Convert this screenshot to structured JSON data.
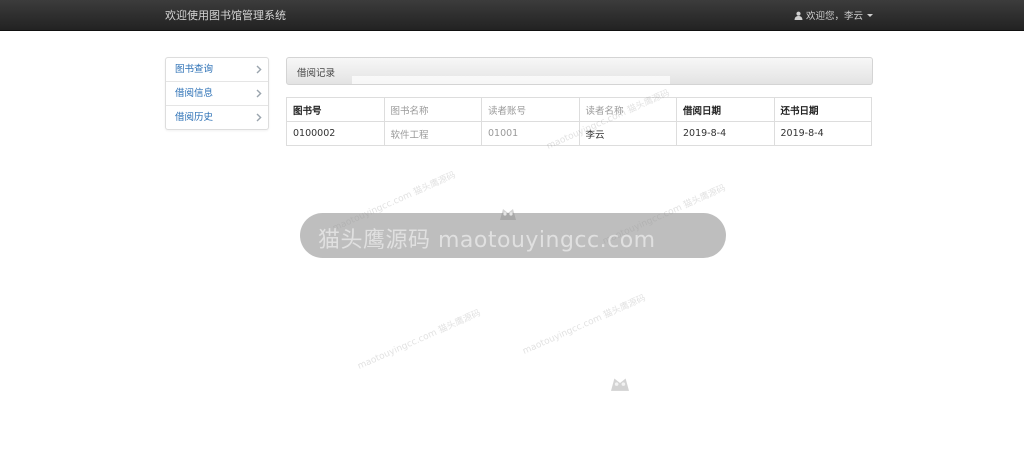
{
  "header": {
    "brand": "欢迎使用图书馆管理系统",
    "user_greeting": "欢迎您，李云"
  },
  "sidebar": {
    "items": [
      {
        "label": "图书查询",
        "icon": "chevron-right-icon"
      },
      {
        "label": "借阅信息",
        "icon": "chevron-right-icon"
      },
      {
        "label": "借阅历史",
        "icon": "chevron-right-icon"
      }
    ]
  },
  "panel": {
    "title": "借阅记录"
  },
  "table": {
    "headers": [
      "图书号",
      "图书名称",
      "读者账号",
      "读者名称",
      "借阅日期",
      "还书日期"
    ],
    "rows": [
      [
        "0100002",
        "软件工程",
        "01001",
        "李云",
        "2019-8-4",
        "2019-8-4"
      ]
    ]
  },
  "watermark": {
    "banner_text": "猫头鹰源码 maotouyingcc.com",
    "small_text": "maotouyingcc.com 猫头鹰源码"
  },
  "colors": {
    "navbar": "#2b2b2b",
    "link": "#2a6fb5",
    "border": "#dddddd"
  }
}
